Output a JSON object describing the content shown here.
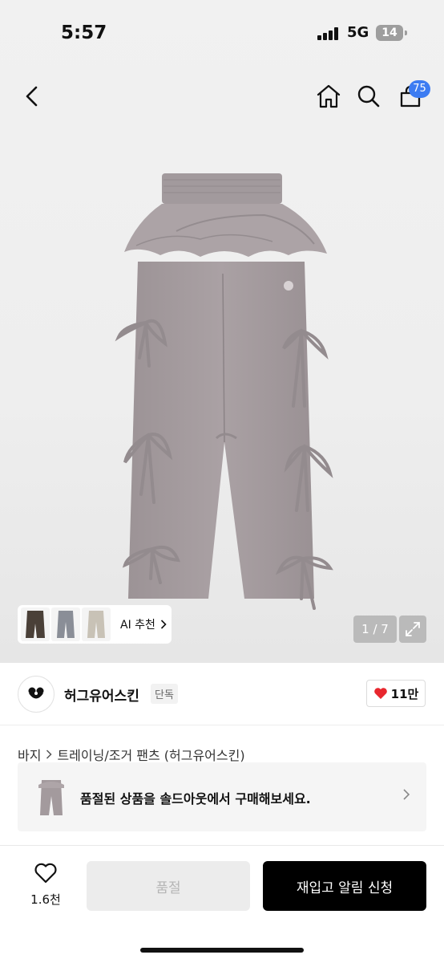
{
  "status_bar": {
    "time": "5:57",
    "network": "5G",
    "battery": "14"
  },
  "nav": {
    "cart_count": "75",
    "icons": [
      "back-arrow-icon",
      "home-icon",
      "search-icon",
      "cart-icon"
    ]
  },
  "gallery": {
    "ai_recommend_label": "AI 추천",
    "page_indicator": "1 / 7"
  },
  "brand": {
    "name": "허그유어스킨",
    "tag": "단독",
    "likes": "11만"
  },
  "breadcrumb": {
    "category": "바지",
    "subcategory": "트레이닝/조거 팬츠 (허그유어스킨)"
  },
  "soldout_banner": {
    "text": "품절된 상품을 솔드아웃에서 구매해보세요."
  },
  "actions": {
    "wish_count": "1.6천",
    "soldout_label": "품절",
    "restock_label": "재입고 알림 신청"
  },
  "colors": {
    "accent_blue": "#3d7cf2",
    "like_red": "#e8272e",
    "primary_button": "#000000",
    "disabled_button": "#ececec",
    "pants_gray": "#a39a9d"
  }
}
